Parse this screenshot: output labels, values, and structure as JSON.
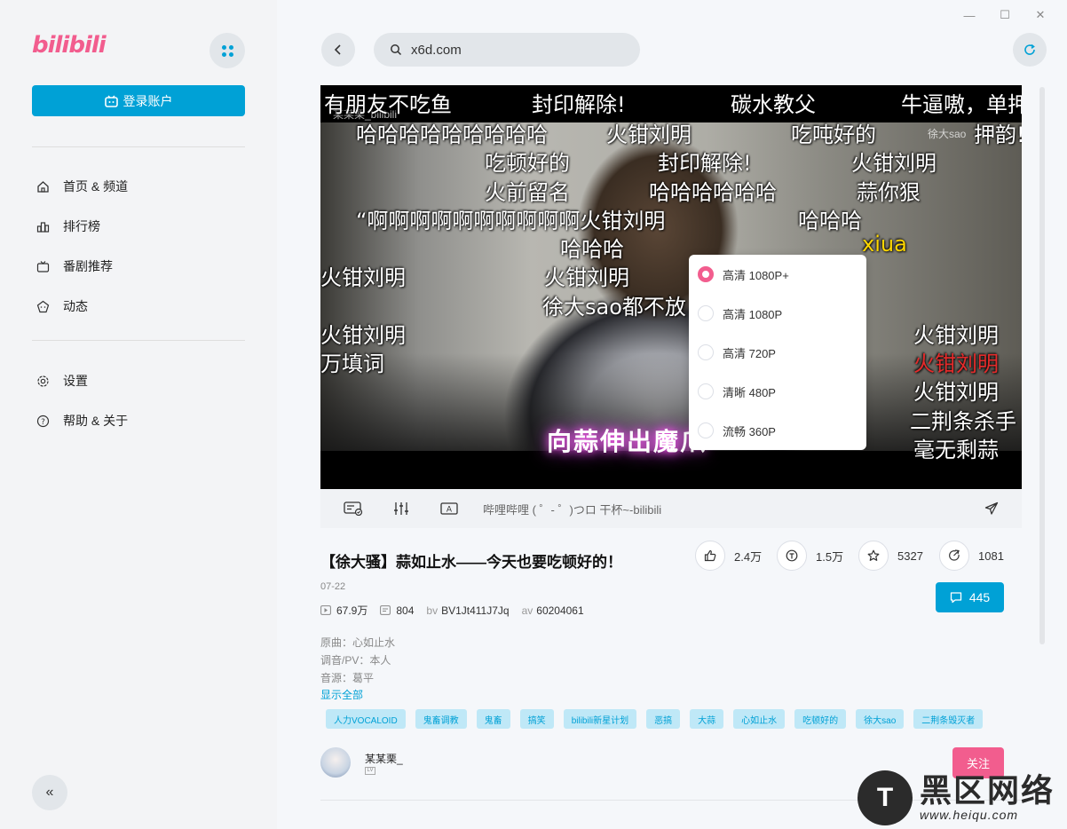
{
  "window": {
    "minimize": "—",
    "maximize": "☐",
    "close": "✕"
  },
  "sidebar": {
    "logo": "bilibili",
    "login_label": "登录账户",
    "nav": [
      {
        "label": "首页 & 频道",
        "icon": "home-icon"
      },
      {
        "label": "排行榜",
        "icon": "ranking-icon"
      },
      {
        "label": "番剧推荐",
        "icon": "tv-icon"
      },
      {
        "label": "动态",
        "icon": "dynamic-icon"
      }
    ],
    "nav2": [
      {
        "label": "设置",
        "icon": "gear-icon"
      },
      {
        "label": "帮助 & 关于",
        "icon": "help-icon"
      }
    ],
    "collapse": "«"
  },
  "browser": {
    "url": "x6d.com"
  },
  "video": {
    "caption": "向蒜伸出魔爪",
    "watermark_left": "某某栗_bilibili",
    "watermark_right": "徐大sao",
    "danmaku": [
      "有朋友不吃鱼",
      "封印解除!",
      "碳水教父",
      "牛逼嗷，单押",
      "哈哈哈哈哈哈哈哈哈",
      "火钳刘明",
      "吃吨好的",
      "押韵!",
      "吃顿好的",
      "封印解除!",
      "火钳刘明",
      "火前留名",
      "哈哈哈哈哈哈",
      "蒜你狠",
      "“啊啊啊啊啊啊啊啊啊啊火钳刘明",
      "哈哈哈",
      "哈哈哈",
      "xiua",
      "火钳刘明",
      "火钳刘明",
      "徐大sao都不放",
      "火钳刘明",
      "火钳刘明",
      "火钳刘明",
      "火钳刘明",
      "万填词",
      "二荆条杀手",
      "毫无剩蒜"
    ]
  },
  "quality": {
    "selected": 0,
    "options": [
      "高清 1080P+",
      "高清 1080P",
      "高清 720P",
      "清晰 480P",
      "流畅 360P"
    ]
  },
  "controls": {
    "danmaku_placeholder": "哔哩哔哩 ( ゜- ゜)つロ 干杯~-bilibili"
  },
  "info": {
    "title": "【徐大骚】蒜如止水——今天也要吃顿好的！",
    "date": "07-22",
    "likes": "2.4万",
    "coins": "1.5万",
    "favorites": "5327",
    "shares": "1081",
    "views": "67.9万",
    "danmaku_count": "804",
    "bv_label": "bv",
    "bv": "BV1Jt411J7Jq",
    "av_label": "av",
    "av": "60204061",
    "comments": "445",
    "desc": [
      "原曲：心如止水",
      "调音/PV：本人",
      "音源：葛平"
    ],
    "show_all": "显示全部",
    "tags": [
      "人力VOCALOID",
      "鬼畜调教",
      "鬼畜",
      "搞笑",
      "bilibili新星计划",
      "恶搞",
      "大蒜",
      "心如止水",
      "吃顿好的",
      "徐大sao",
      "二荆条毁灭者"
    ]
  },
  "uploader": {
    "name": "某某栗_",
    "level": "LV",
    "follow": "关注"
  },
  "site_watermark": {
    "logo": "T",
    "cn": "黑区网络",
    "en": "www.heiqu.com"
  }
}
